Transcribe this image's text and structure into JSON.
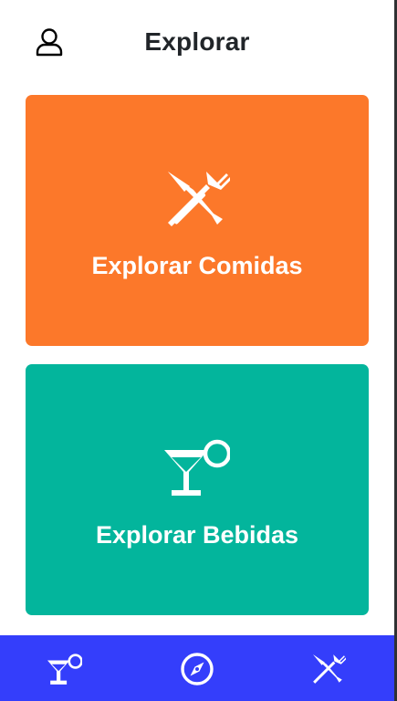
{
  "header": {
    "title": "Explorar",
    "profile_icon": "person-outline-icon"
  },
  "cards": {
    "foods": {
      "label": "Explorar Comidas",
      "icon": "fork-knife-icon",
      "color": "#fc782a"
    },
    "drinks": {
      "label": "Explorar Bebidas",
      "icon": "cocktail-glass-icon",
      "color": "#03b59c"
    }
  },
  "bottom_nav": {
    "color": "#343efb",
    "items": [
      {
        "icon": "cocktail-glass-icon"
      },
      {
        "icon": "compass-icon"
      },
      {
        "icon": "fork-knife-icon"
      }
    ]
  }
}
